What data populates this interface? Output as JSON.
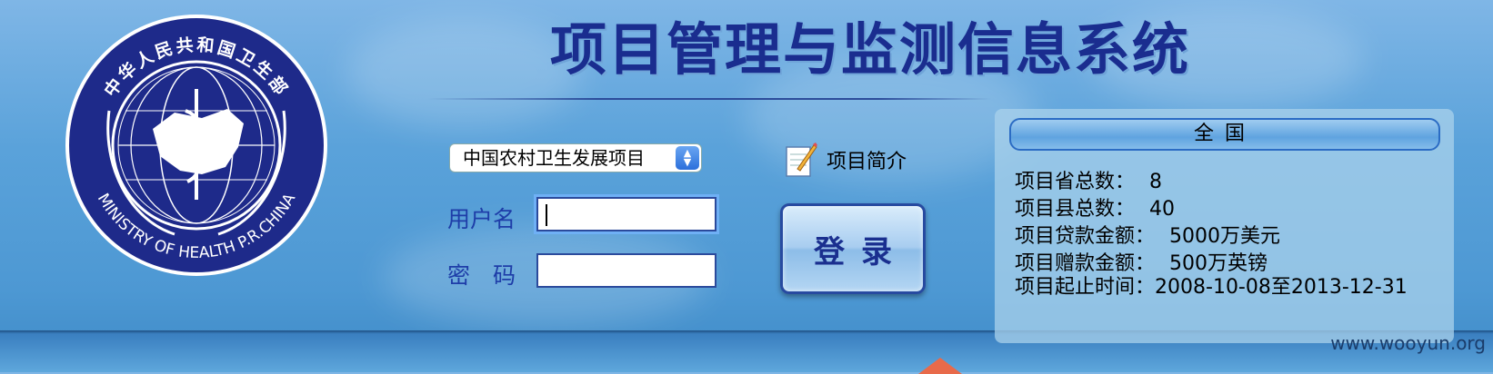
{
  "header": {
    "title": "项目管理与监测信息系统",
    "logo": {
      "top_text": "中华人民共和国卫生部",
      "bottom_text": "MINISTRY OF HEALTH P.R.CHINA",
      "icon": "ministry-of-health-seal"
    }
  },
  "login": {
    "project_select": {
      "selected": "中国农村卫生发展项目"
    },
    "username_label": "用户名",
    "username_value": "",
    "password_label": "密　码",
    "password_value": "",
    "intro_label": "项目简介",
    "intro_icon": "notepad-pencil-icon",
    "login_button": "登录"
  },
  "info_panel": {
    "header": "全国",
    "rows": [
      {
        "label": "项目省总数：",
        "value": "8"
      },
      {
        "label": "项目县总数：",
        "value": "40"
      },
      {
        "label": "项目贷款金额：",
        "value": "5000万美元"
      },
      {
        "label": "项目赠款金额：",
        "value": "500万英镑"
      },
      {
        "label": "项目起止时间：",
        "value": "2008-10-08至2013-12-31"
      }
    ]
  },
  "watermark": "www.wooyun.org"
}
